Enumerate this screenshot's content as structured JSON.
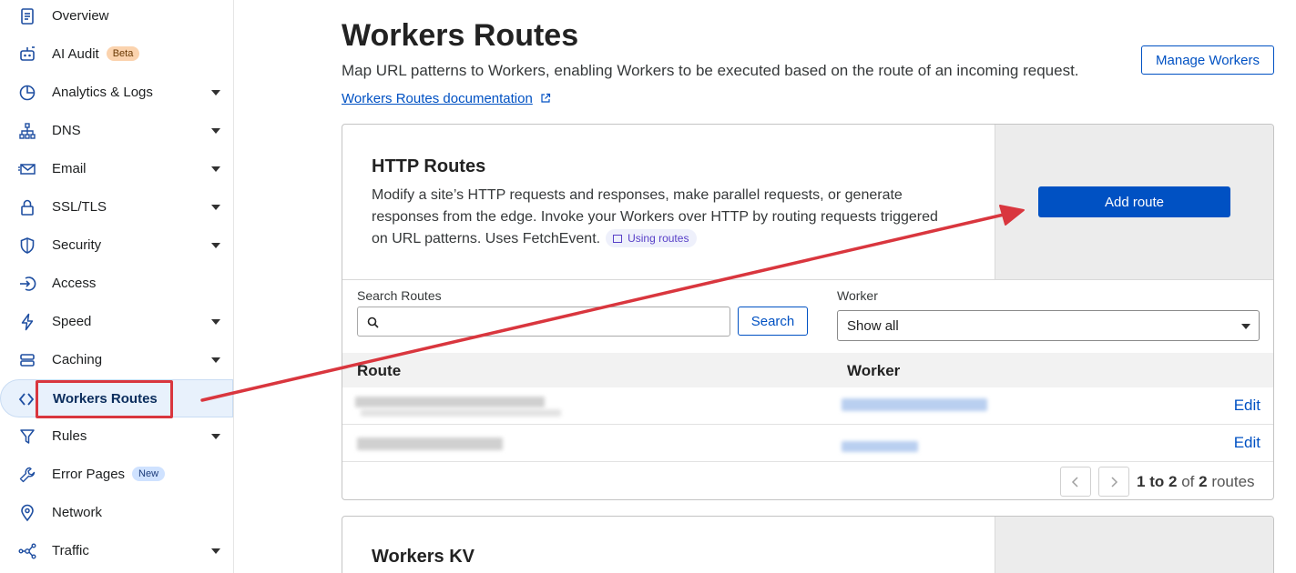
{
  "sidebar": {
    "items": [
      {
        "name": "overview",
        "label": "Overview",
        "icon": "document-icon",
        "caret": false
      },
      {
        "name": "ai-audit",
        "label": "AI Audit",
        "icon": "robot-icon",
        "caret": false,
        "badge": "Beta"
      },
      {
        "name": "analytics-logs",
        "label": "Analytics & Logs",
        "icon": "pie-chart-icon",
        "caret": true
      },
      {
        "name": "dns",
        "label": "DNS",
        "icon": "network-tree-icon",
        "caret": true
      },
      {
        "name": "email",
        "label": "Email",
        "icon": "envelope-icon",
        "caret": true
      },
      {
        "name": "ssl-tls",
        "label": "SSL/TLS",
        "icon": "lock-icon",
        "caret": true
      },
      {
        "name": "security",
        "label": "Security",
        "icon": "shield-icon",
        "caret": true
      },
      {
        "name": "access",
        "label": "Access",
        "icon": "access-arrow-icon",
        "caret": false
      },
      {
        "name": "speed",
        "label": "Speed",
        "icon": "lightning-icon",
        "caret": true
      },
      {
        "name": "caching",
        "label": "Caching",
        "icon": "storage-icon",
        "caret": true
      },
      {
        "name": "workers-routes",
        "label": "Workers Routes",
        "icon": "workers-icon",
        "caret": false,
        "active": true
      },
      {
        "name": "rules",
        "label": "Rules",
        "icon": "funnel-icon",
        "caret": true
      },
      {
        "name": "error-pages",
        "label": "Error Pages",
        "icon": "wrench-icon",
        "caret": false,
        "badge": "New"
      },
      {
        "name": "network",
        "label": "Network",
        "icon": "location-pin-icon",
        "caret": false
      },
      {
        "name": "traffic",
        "label": "Traffic",
        "icon": "traffic-icon",
        "caret": true
      }
    ]
  },
  "header": {
    "title": "Workers Routes",
    "description": "Map URL patterns to Workers, enabling Workers to be executed based on the route of an incoming request.",
    "doc_link": "Workers Routes documentation",
    "manage_button": "Manage Workers"
  },
  "http_routes": {
    "title": "HTTP Routes",
    "description": "Modify a site’s HTTP requests and responses, make parallel requests, or generate responses from the edge. Invoke your Workers over HTTP by routing requests triggered on URL patterns. Uses FetchEvent.",
    "pill": "Using routes",
    "add_button": "Add route",
    "search_label": "Search Routes",
    "search_value": "",
    "search_button": "Search",
    "worker_label": "Worker",
    "worker_selected": "Show all",
    "columns": [
      "Route",
      "Worker"
    ],
    "rows": [
      {
        "edit": "Edit"
      },
      {
        "edit": "Edit"
      }
    ],
    "pagination": {
      "start": "1",
      "to": "to",
      "end": "2",
      "of": "of",
      "total": "2",
      "unit": "routes"
    }
  },
  "workers_kv": {
    "title": "Workers KV"
  },
  "colors": {
    "accent": "#0051c3",
    "annotation": "#d9363e"
  }
}
